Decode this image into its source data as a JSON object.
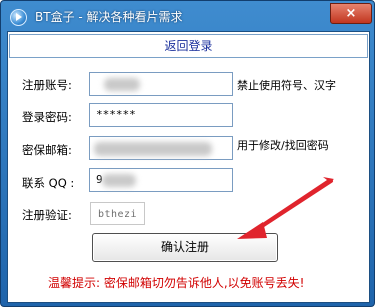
{
  "window": {
    "title": "BT盒子 - 解决各种看片需求",
    "close_label": "×"
  },
  "header": {
    "return_link": "返回登录"
  },
  "form": {
    "username": {
      "label": "注册账号:",
      "hint": "禁止使用符号、汉字"
    },
    "password": {
      "label": "登录密码:",
      "value": "******"
    },
    "email": {
      "label": "密保邮箱:",
      "hint": "用于修改/找回密码"
    },
    "qq": {
      "label": "联系 QQ :",
      "value": "9"
    },
    "captcha": {
      "label": "注册验证:",
      "code": "bthezi"
    },
    "submit_label": "确认注册"
  },
  "warning": "温馨提示: 密保邮箱切勿告诉他人,以免账号丢失!",
  "colors": {
    "titlebar": "#2a72bb",
    "link": "#1a2f9c",
    "warning": "#d10000",
    "arrow": "#e0242d"
  }
}
